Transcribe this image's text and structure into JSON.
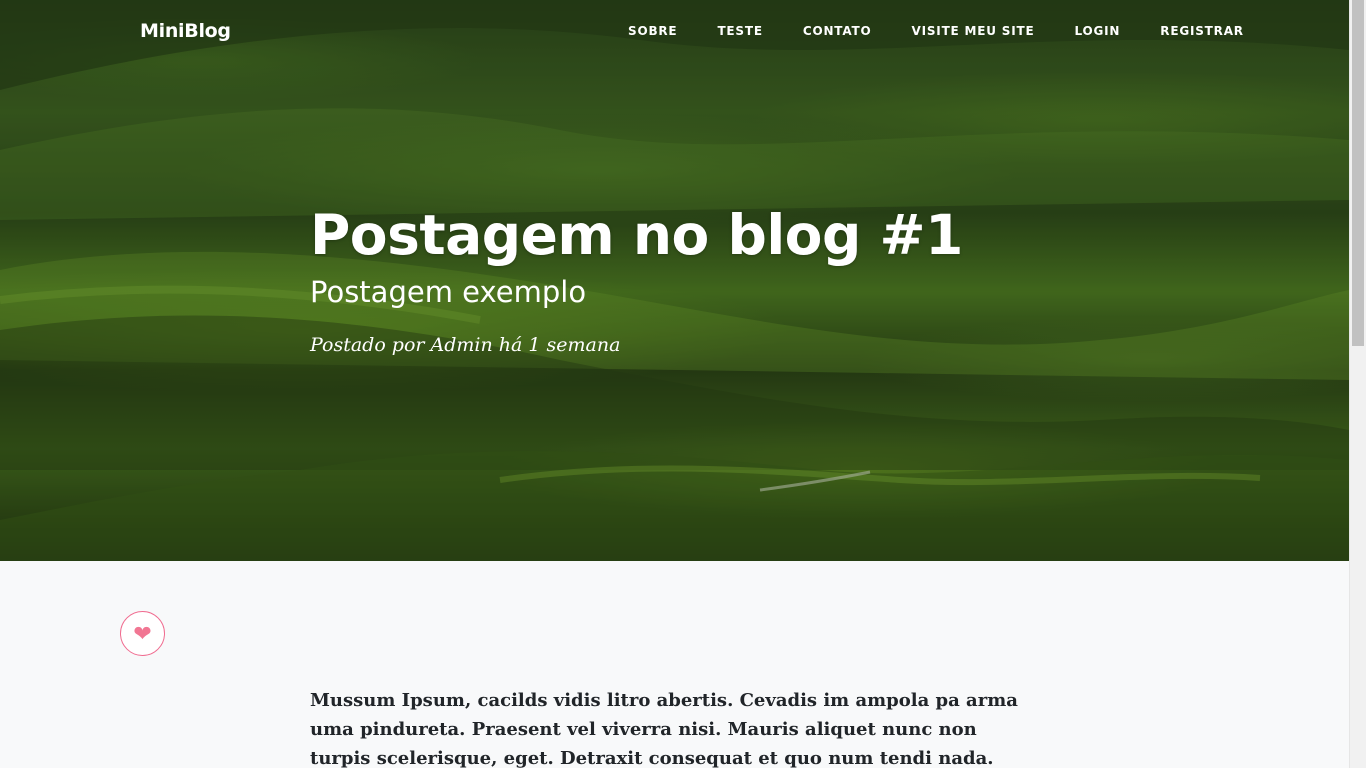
{
  "nav": {
    "brand": "MiniBlog",
    "links": [
      "SOBRE",
      "TESTE",
      "CONTATO",
      "VISITE MEU SITE",
      "LOGIN",
      "REGISTRAR"
    ]
  },
  "post": {
    "title": "Postagem no blog #1",
    "subtitle": "Postagem exemplo",
    "meta": "Postado por Admin há 1 semana",
    "body": "Mussum Ipsum, cacilds vidis litro abertis. Cevadis im ampola pa arma uma pindureta. Praesent vel viverra nisi. Mauris aliquet nunc non turpis scelerisque, eget. Detraxit consequat et quo num tendi nada. Suco de"
  },
  "like": {
    "icon": "heart-icon",
    "color": "#f17693"
  },
  "colors": {
    "page_bg": "#f8f9fa",
    "text": "#212529"
  }
}
